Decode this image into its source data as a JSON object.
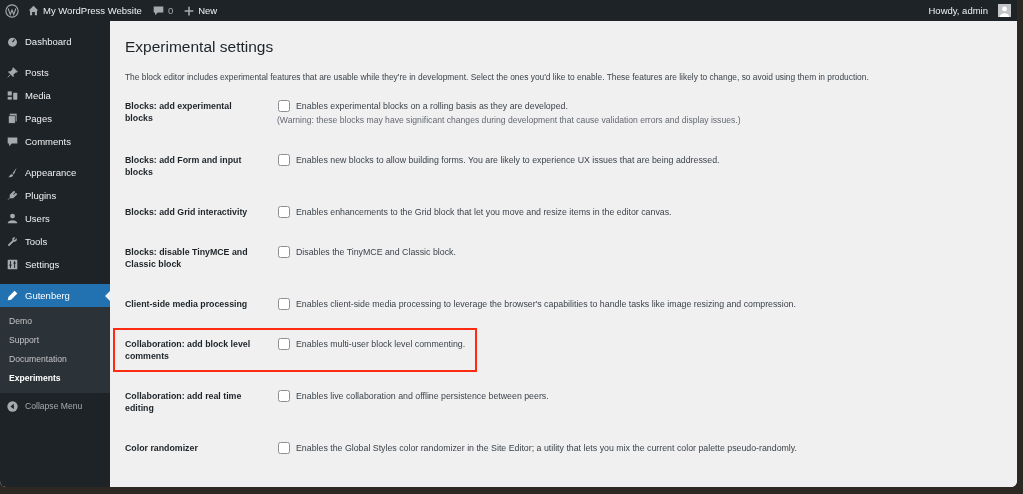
{
  "admin_bar": {
    "site_name": "My WordPress Website",
    "comments_count": "0",
    "new_label": "New",
    "greeting": "Howdy, admin"
  },
  "sidebar": {
    "groups": [
      [
        {
          "label": "Dashboard",
          "selected": false
        }
      ],
      [
        {
          "label": "Posts",
          "selected": false
        },
        {
          "label": "Media",
          "selected": false
        },
        {
          "label": "Pages",
          "selected": false
        },
        {
          "label": "Comments",
          "selected": false
        }
      ],
      [
        {
          "label": "Appearance",
          "selected": false
        },
        {
          "label": "Plugins",
          "selected": false
        },
        {
          "label": "Users",
          "selected": false
        },
        {
          "label": "Tools",
          "selected": false
        },
        {
          "label": "Settings",
          "selected": false
        }
      ],
      [
        {
          "label": "Gutenberg",
          "selected": true,
          "children": [
            {
              "label": "Demo",
              "selected": false
            },
            {
              "label": "Support",
              "selected": false
            },
            {
              "label": "Documentation",
              "selected": false
            },
            {
              "label": "Experiments",
              "selected": true
            }
          ]
        }
      ]
    ],
    "collapse_label": "Collapse Menu"
  },
  "page": {
    "title": "Experimental settings",
    "intro": "The block editor includes experimental features that are usable while they're in development. Select the ones you'd like to enable. These features are likely to change, so avoid using them in production.",
    "settings": [
      {
        "label": "Blocks: add experimental blocks",
        "description": "Enables experimental blocks on a rolling basis as they are developed.",
        "note": "(Warning: these blocks may have significant changes during development that cause validation errors and display issues.)",
        "checked": false,
        "highlighted": false
      },
      {
        "label": "Blocks: add Form and input blocks",
        "description": "Enables new blocks to allow building forms. You are likely to experience UX issues that are being addressed.",
        "checked": false,
        "highlighted": false
      },
      {
        "label": "Blocks: add Grid interactivity",
        "description": "Enables enhancements to the Grid block that let you move and resize items in the editor canvas.",
        "checked": false,
        "highlighted": false
      },
      {
        "label": "Blocks: disable TinyMCE and Classic block",
        "description": "Disables the TinyMCE and Classic block.",
        "checked": false,
        "highlighted": false
      },
      {
        "label": "Client-side media processing",
        "description": "Enables client-side media processing to leverage the browser's capabilities to handle tasks like image resizing and compression.",
        "checked": false,
        "highlighted": false
      },
      {
        "label": "Collaboration: add block level comments",
        "description": "Enables multi-user block level commenting.",
        "checked": false,
        "highlighted": true
      },
      {
        "label": "Collaboration: add real time editing",
        "description": "Enables live collaboration and offline persistence between peers.",
        "checked": false,
        "highlighted": false
      },
      {
        "label": "Color randomizer",
        "description": "Enables the Global Styles color randomizer in the Site Editor; a utility that lets you mix the current color palette pseudo-randomly.",
        "checked": false,
        "highlighted": false
      }
    ]
  }
}
